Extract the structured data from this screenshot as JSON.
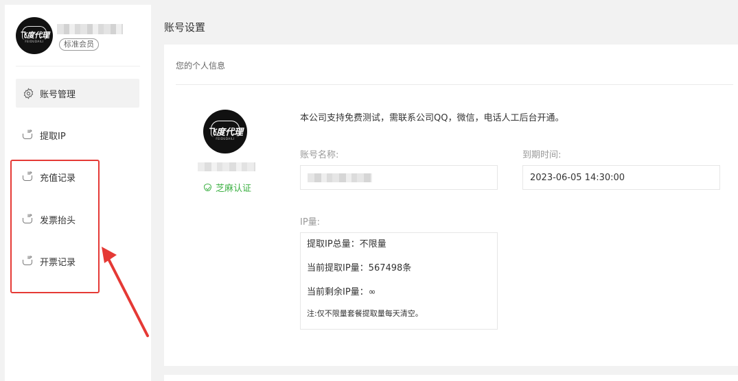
{
  "sidebar": {
    "logo_text": "飞度代理",
    "logo_sub": "FEIDUDAILI",
    "member_badge": "标准会员",
    "items": [
      {
        "label": "账号管理",
        "icon": "gear-icon"
      },
      {
        "label": "提取IP",
        "icon": "ip-hand-icon"
      },
      {
        "label": "充值记录",
        "icon": "ip-hand-icon"
      },
      {
        "label": "发票抬头",
        "icon": "ip-hand-icon"
      },
      {
        "label": "开票记录",
        "icon": "ip-hand-icon"
      }
    ]
  },
  "main": {
    "page_title": "账号设置",
    "card_title": "您的个人信息",
    "verified_label": "芝麻认证",
    "notice": "本公司支持免费测试，需联系公司QQ，微信，电话人工后台开通。",
    "account_name_label": "账号名称:",
    "expiry_label": "到期时间:",
    "expiry_value": "2023-06-05 14:30:00",
    "ip_label": "IP量:",
    "ip_total": "提取IP总量：不限量",
    "ip_current": "当前提取IP量：567498条",
    "ip_remaining": "当前剩余IP量：∞",
    "ip_note": "注:仅不限量套餐提取量每天清空。"
  },
  "colors": {
    "highlight_box": "#e53935",
    "verified": "#3cb043"
  }
}
